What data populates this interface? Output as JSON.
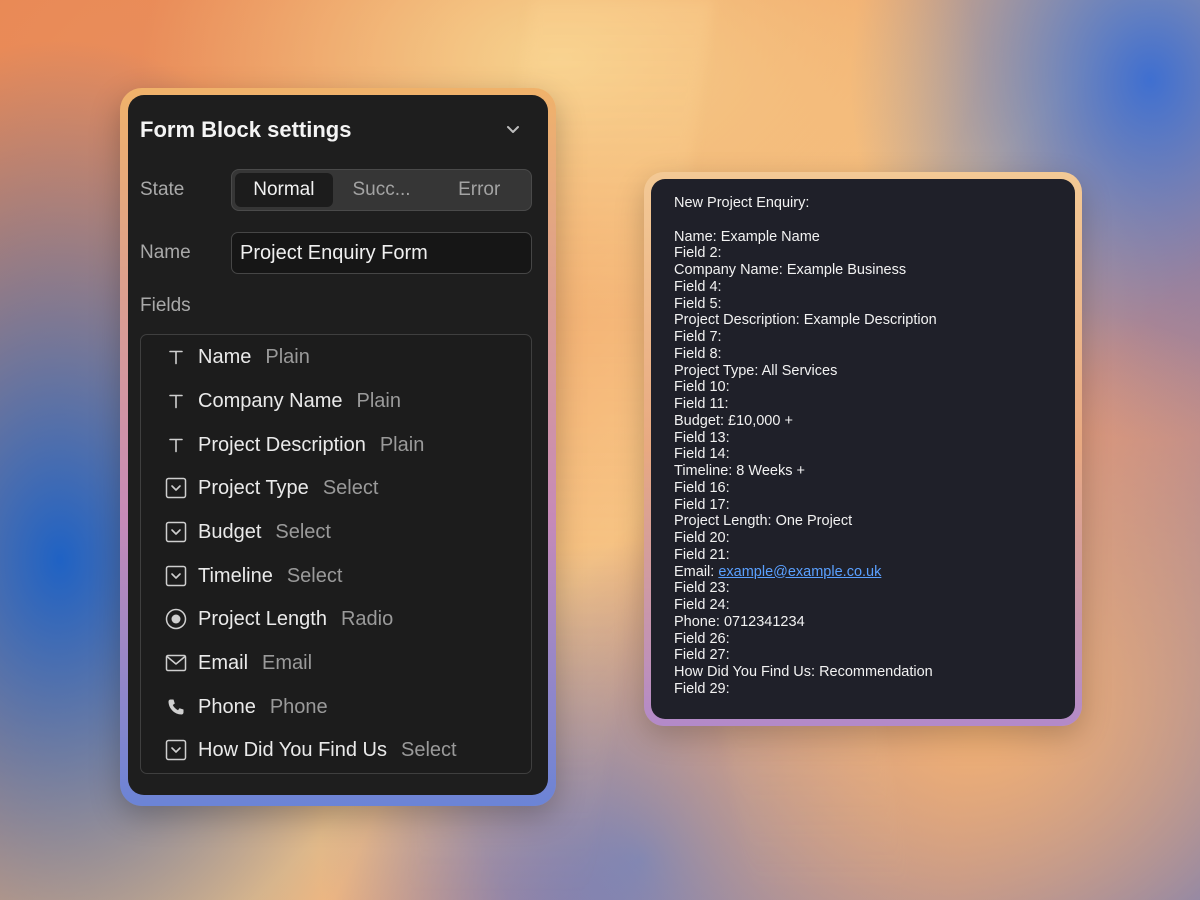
{
  "settings": {
    "title": "Form Block settings",
    "state_label": "State",
    "state_options": [
      "Normal",
      "Succ...",
      "Error"
    ],
    "state_selected": "Normal",
    "name_label": "Name",
    "name_value": "Project Enquiry Form",
    "fields_label": "Fields",
    "fields": [
      {
        "name": "Name",
        "type": "Plain",
        "icon": "text-icon"
      },
      {
        "name": "Company Name",
        "type": "Plain",
        "icon": "text-icon"
      },
      {
        "name": "Project Description",
        "type": "Plain",
        "icon": "text-icon"
      },
      {
        "name": "Project Type",
        "type": "Select",
        "icon": "select-icon"
      },
      {
        "name": "Budget",
        "type": "Select",
        "icon": "select-icon"
      },
      {
        "name": "Timeline",
        "type": "Select",
        "icon": "select-icon"
      },
      {
        "name": "Project Length",
        "type": "Radio",
        "icon": "radio-icon"
      },
      {
        "name": "Email",
        "type": "Email",
        "icon": "mail-icon"
      },
      {
        "name": "Phone",
        "type": "Phone",
        "icon": "phone-icon"
      },
      {
        "name": "How Did You Find Us",
        "type": "Select",
        "icon": "select-icon"
      }
    ]
  },
  "preview": {
    "heading": "New Project Enquiry:",
    "lines": [
      "Name: Example Name",
      "Field 2:",
      "Company Name: Example Business",
      "Field 4:",
      "Field 5:",
      "Project Description: Example Description",
      "Field 7:",
      "Field 8:",
      "Project Type: All Services",
      "Field 10:",
      "Field 11:",
      "Budget: £10,000 +",
      "Field 13:",
      "Field 14:",
      "Timeline: 8 Weeks +",
      "Field 16:",
      "Field 17:",
      "Project Length: One Project",
      "Field 20:",
      "Field 21:",
      "Email: ",
      "Field 23:",
      "Field 24:",
      "Phone: 0712341234",
      "Field 26:",
      "Field 27:",
      "How Did You Find Us: Recommendation",
      "Field 29:"
    ],
    "email_link": "example@example.co.uk"
  },
  "colors": {
    "panel_bg": "#1e1e1e",
    "preview_bg": "#1f2029",
    "link": "#5aa0ff"
  }
}
